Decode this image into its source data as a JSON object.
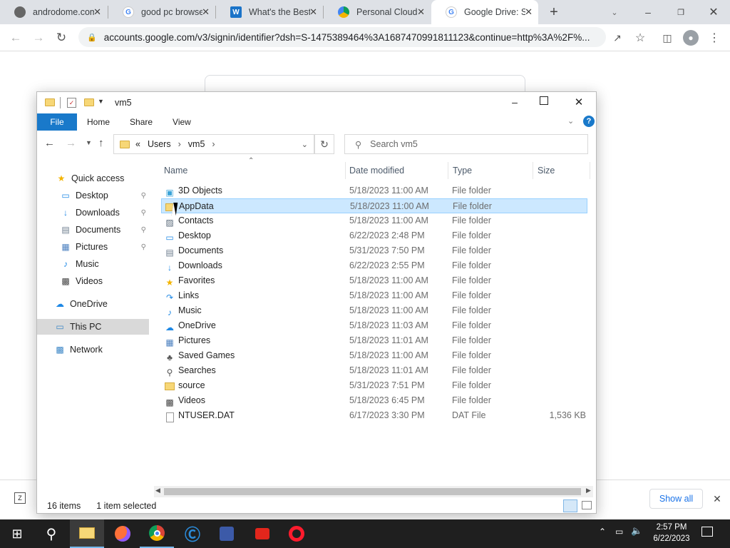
{
  "browser": {
    "tabs": [
      {
        "title": "androdome.com",
        "icon": "androdome-icon"
      },
      {
        "title": "good pc browsers",
        "icon": "google-icon"
      },
      {
        "title": "What's the Best",
        "icon": "w-icon"
      },
      {
        "title": "Personal Cloud",
        "icon": "google-drive-icon"
      },
      {
        "title": "Google Drive: Sign",
        "icon": "google-icon"
      }
    ],
    "url": "accounts.google.com/v3/signin/identifier?dsh=S-1475389464%3A1687470991811123&continue=http%3A%2F%..."
  },
  "explorer": {
    "title": "vm5",
    "ribbon_tabs": [
      "File",
      "Home",
      "Share",
      "View"
    ],
    "breadcrumb": [
      "Users",
      "vm5"
    ],
    "breadcrumb_prefix": "«",
    "search_placeholder": "Search vm5",
    "nav": [
      {
        "label": "Quick access",
        "icon": "star-icon"
      },
      {
        "label": "Desktop",
        "icon": "desktop-icon"
      },
      {
        "label": "Downloads",
        "icon": "downloads-icon"
      },
      {
        "label": "Documents",
        "icon": "documents-icon"
      },
      {
        "label": "Pictures",
        "icon": "pictures-icon"
      },
      {
        "label": "Music",
        "icon": "music-icon"
      },
      {
        "label": "Videos",
        "icon": "videos-icon"
      },
      {
        "label": "OneDrive",
        "icon": "cloud-icon"
      },
      {
        "label": "This PC",
        "icon": "computer-icon"
      },
      {
        "label": "Network",
        "icon": "network-icon"
      }
    ],
    "columns": [
      "Name",
      "Date modified",
      "Type",
      "Size"
    ],
    "files": [
      {
        "name": "3D Objects",
        "date": "5/18/2023 11:00 AM",
        "type": "File folder",
        "size": "",
        "icon": "cube-icon"
      },
      {
        "name": "AppData",
        "date": "5/18/2023 11:00 AM",
        "type": "File folder",
        "size": "",
        "icon": "folder-icon"
      },
      {
        "name": "Contacts",
        "date": "5/18/2023 11:00 AM",
        "type": "File folder",
        "size": "",
        "icon": "contacts-icon"
      },
      {
        "name": "Desktop",
        "date": "6/22/2023 2:48 PM",
        "type": "File folder",
        "size": "",
        "icon": "desktop-icon"
      },
      {
        "name": "Documents",
        "date": "5/31/2023 7:50 PM",
        "type": "File folder",
        "size": "",
        "icon": "documents-icon"
      },
      {
        "name": "Downloads",
        "date": "6/22/2023 2:55 PM",
        "type": "File folder",
        "size": "",
        "icon": "downloads-icon"
      },
      {
        "name": "Favorites",
        "date": "5/18/2023 11:00 AM",
        "type": "File folder",
        "size": "",
        "icon": "star-icon"
      },
      {
        "name": "Links",
        "date": "5/18/2023 11:00 AM",
        "type": "File folder",
        "size": "",
        "icon": "link-icon"
      },
      {
        "name": "Music",
        "date": "5/18/2023 11:00 AM",
        "type": "File folder",
        "size": "",
        "icon": "music-icon"
      },
      {
        "name": "OneDrive",
        "date": "5/18/2023 11:03 AM",
        "type": "File folder",
        "size": "",
        "icon": "cloud-icon"
      },
      {
        "name": "Pictures",
        "date": "5/18/2023 11:01 AM",
        "type": "File folder",
        "size": "",
        "icon": "pictures-icon"
      },
      {
        "name": "Saved Games",
        "date": "5/18/2023 11:00 AM",
        "type": "File folder",
        "size": "",
        "icon": "games-icon"
      },
      {
        "name": "Searches",
        "date": "5/18/2023 11:01 AM",
        "type": "File folder",
        "size": "",
        "icon": "search-icon"
      },
      {
        "name": "source",
        "date": "5/31/2023 7:51 PM",
        "type": "File folder",
        "size": "",
        "icon": "folder-icon"
      },
      {
        "name": "Videos",
        "date": "5/18/2023 6:45 PM",
        "type": "File folder",
        "size": "",
        "icon": "videos-icon"
      },
      {
        "name": "NTUSER.DAT",
        "date": "6/17/2023 3:30 PM",
        "type": "DAT File",
        "size": "1,536 KB",
        "icon": "file-icon"
      }
    ],
    "status_items": "16 items",
    "status_selected": "1 item selected"
  },
  "download_bar": {
    "show_all": "Show all"
  },
  "taskbar": {
    "time": "2:57 PM",
    "date": "6/22/2023"
  },
  "colors": {
    "accent": "#1979ca",
    "selection": "#cce8ff",
    "taskbar": "#1f1f1f"
  }
}
